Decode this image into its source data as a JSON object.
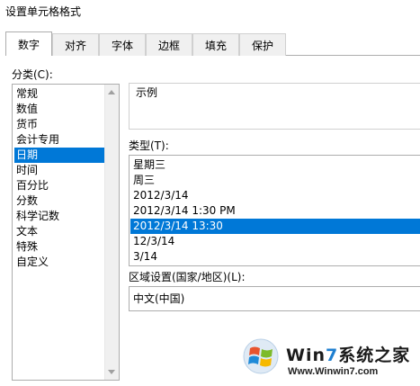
{
  "dialog": {
    "title": "设置单元格格式"
  },
  "tabs": [
    {
      "label": "数字",
      "active": true
    },
    {
      "label": "对齐"
    },
    {
      "label": "字体"
    },
    {
      "label": "边框"
    },
    {
      "label": "填充"
    },
    {
      "label": "保护"
    }
  ],
  "category": {
    "label": "分类(C):",
    "items": [
      "常规",
      "数值",
      "货币",
      "会计专用",
      "日期",
      "时间",
      "百分比",
      "分数",
      "科学记数",
      "文本",
      "特殊",
      "自定义"
    ],
    "selected_index": 4
  },
  "sample": {
    "label": "示例",
    "value": ""
  },
  "type": {
    "label": "类型(T):",
    "items": [
      "星期三",
      "周三",
      "2012/3/14",
      "2012/3/14 1:30 PM",
      "2012/3/14 13:30",
      "12/3/14",
      "3/14"
    ],
    "selected_index": 4
  },
  "locale": {
    "label": "区域设置(国家/地区)(L):",
    "value": "中文(中国)"
  },
  "watermark": {
    "brand_prefix": "Win",
    "brand_seven": "7",
    "brand_suffix": "系统之家",
    "url": "Www.Winwin7.com"
  },
  "colors": {
    "selection": "#0078d7",
    "border": "#adadad",
    "tab_bg": "#f0f0f0"
  }
}
